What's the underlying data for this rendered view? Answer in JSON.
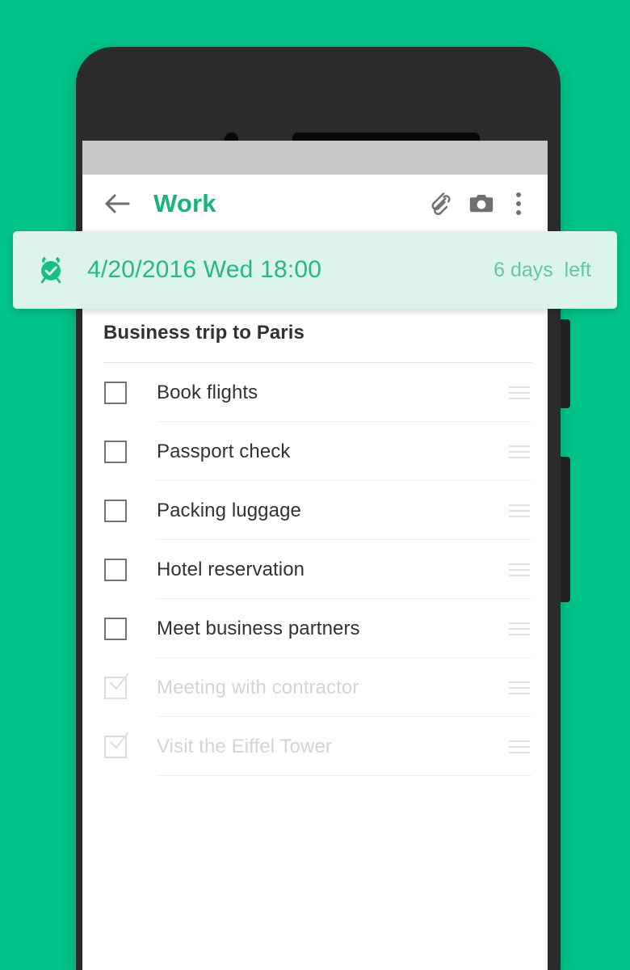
{
  "theme": {
    "background_green": "#02c389",
    "accent_green": "#19b37c",
    "reminder_card_bg": "#ddf4ec",
    "reminder_text": "#27b980",
    "reminder_muted": "#66c6a4",
    "phone_body": "#2b2b2b",
    "status_bar": "#c8c8c8",
    "text_primary": "#2f3336",
    "text_done": "#d4d4d4"
  },
  "app_bar": {
    "back_icon": "arrow-left-icon",
    "title": "Work",
    "actions": [
      {
        "name": "attachment-button",
        "icon": "paperclip-icon"
      },
      {
        "name": "camera-button",
        "icon": "camera-icon"
      },
      {
        "name": "overflow-menu-button",
        "icon": "more-vertical-icon"
      }
    ]
  },
  "reminder": {
    "icon": "alarm-check-icon",
    "datetime": "4/20/2016 Wed 18:00",
    "countdown": "6 days  left"
  },
  "note": {
    "title": "Business trip to Paris"
  },
  "tasks": [
    {
      "label": "Book flights",
      "done": false
    },
    {
      "label": "Passport check",
      "done": false
    },
    {
      "label": "Packing luggage",
      "done": false
    },
    {
      "label": "Hotel reservation",
      "done": false
    },
    {
      "label": "Meet business partners",
      "done": false
    },
    {
      "label": "Meeting with contractor",
      "done": true
    },
    {
      "label": "Visit the Eiffel Tower",
      "done": true
    }
  ]
}
